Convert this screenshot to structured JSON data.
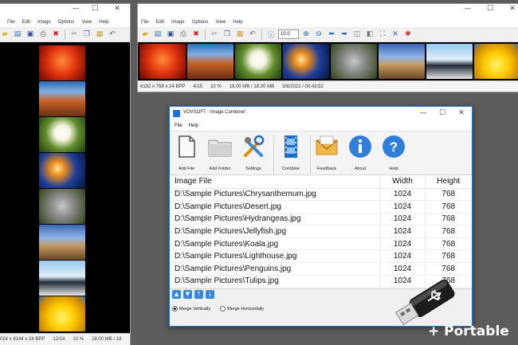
{
  "viewer": {
    "menu": [
      "File",
      "Edit",
      "Image",
      "Options",
      "View",
      "Help"
    ],
    "zoom": "10.0",
    "left_status": [
      "024 x 6144 x 24 BPP",
      "12/14",
      "10 %",
      "18.00 MB / 18"
    ],
    "right_status": [
      "6192 x 768 x 24 BPP",
      "4/15",
      "10 %",
      "18.00 MB / 18.00 MB",
      "5/8/2022 / 00:43:52"
    ]
  },
  "dialog": {
    "title": "VOVSOFT - Image Combiner",
    "menu": [
      "File",
      "Help"
    ],
    "ribbon": [
      "Add File",
      "Add Folder",
      "Settings",
      "Combine",
      "Feedback",
      "About",
      "Help"
    ],
    "columns": [
      "Image File",
      "Width",
      "Height"
    ],
    "rows": [
      [
        "D:\\Sample Pictures\\Chrysanthemum.jpg",
        "1024",
        "768"
      ],
      [
        "D:\\Sample Pictures\\Desert.jpg",
        "1024",
        "768"
      ],
      [
        "D:\\Sample Pictures\\Hydrangeas.jpg",
        "1024",
        "768"
      ],
      [
        "D:\\Sample Pictures\\Jellyfish.jpg",
        "1024",
        "768"
      ],
      [
        "D:\\Sample Pictures\\Koala.jpg",
        "1024",
        "768"
      ],
      [
        "D:\\Sample Pictures\\Lighthouse.jpg",
        "1024",
        "768"
      ],
      [
        "D:\\Sample Pictures\\Penguins.jpg",
        "1024",
        "768"
      ],
      [
        "D:\\Sample Pictures\\Tulips.jpg",
        "1024",
        "768"
      ]
    ],
    "merge_vertically": "Merge Vertically",
    "merge_horizontally": "Merge Horizontally"
  },
  "badge": "+ Portable",
  "colors": {
    "accent": "#1a73d9",
    "background": "#5c5c5c"
  }
}
